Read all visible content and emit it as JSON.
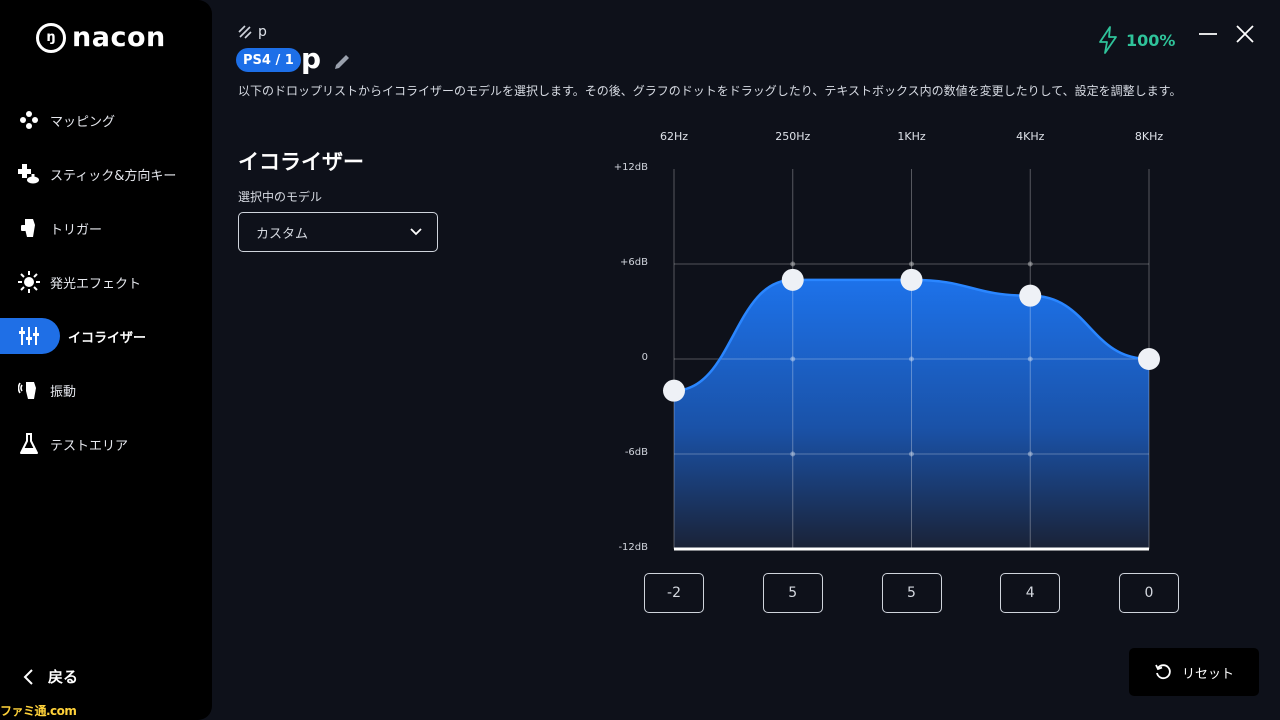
{
  "brand": {
    "logo_text": "nacon"
  },
  "sidebar": {
    "items": [
      {
        "label": "マッピング",
        "icon": "dpad-icon",
        "active": false
      },
      {
        "label": "スティック&方向キー",
        "icon": "stick-dpad-icon",
        "active": false
      },
      {
        "label": "トリガー",
        "icon": "trigger-icon",
        "active": false
      },
      {
        "label": "発光エフェクト",
        "icon": "light-icon",
        "active": false
      },
      {
        "label": "イコライザー",
        "icon": "equalizer-icon",
        "active": true
      },
      {
        "label": "振動",
        "icon": "vibration-icon",
        "active": false
      },
      {
        "label": "テストエリア",
        "icon": "flask-icon",
        "active": false
      }
    ],
    "back_label": "戻る"
  },
  "watermark": "ファミ通.com",
  "header": {
    "small_name": "p",
    "badge": "PS4 / 1",
    "profile_name": "p",
    "description": "以下のドロップリストからイコライザーのモデルを選択します。その後、グラフのドットをドラッグしたり、テキストボックス内の数値を変更したりして、設定を調整します。"
  },
  "battery": {
    "level": "100%",
    "color": "#2fc39a"
  },
  "equalizer": {
    "title": "イコライザー",
    "model_label": "選択中のモデル",
    "model_value": "カスタム",
    "bands": [
      {
        "freq": "62Hz",
        "value": -2
      },
      {
        "freq": "250Hz",
        "value": 5
      },
      {
        "freq": "1KHz",
        "value": 5
      },
      {
        "freq": "4KHz",
        "value": 4
      },
      {
        "freq": "8KHz",
        "value": 0
      }
    ],
    "db_labels": [
      "+12dB",
      "+6dB",
      "0",
      "-6dB",
      "-12dB"
    ],
    "db_range": [
      -12,
      12
    ],
    "accent": "#1d72ea"
  },
  "reset_label": "リセット"
}
